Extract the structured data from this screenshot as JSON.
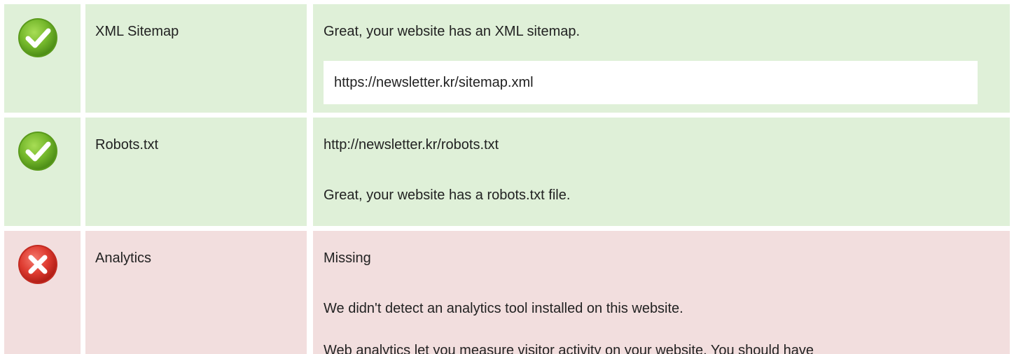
{
  "checks": [
    {
      "label": "XML Sitemap",
      "status_icon": "check-icon",
      "message": "Great, your website has an XML sitemap.",
      "url": "https://newsletter.kr/sitemap.xml"
    },
    {
      "label": "Robots.txt",
      "status_icon": "check-icon",
      "url": "http://newsletter.kr/robots.txt",
      "message": "Great, your website has a robots.txt file."
    },
    {
      "label": "Analytics",
      "status_icon": "cross-icon",
      "status_text": "Missing",
      "message": "We didn't detect an analytics tool installed on this website.",
      "message2": "Web analytics let you measure visitor activity on your website. You should have"
    }
  ],
  "colors": {
    "pass_bg": "#dff0d8",
    "fail_bg": "#f2dede",
    "pass_icon": "#6fb526",
    "fail_icon": "#d9302b"
  }
}
